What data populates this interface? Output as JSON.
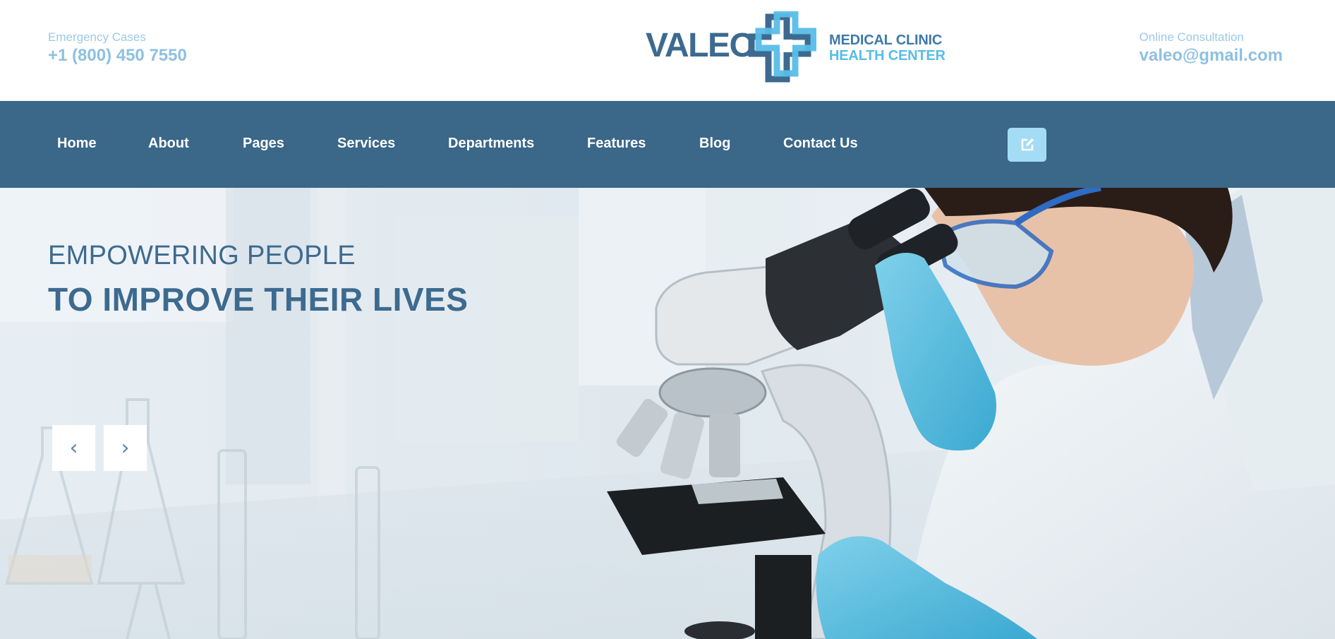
{
  "header": {
    "emergency_label": "Emergency Cases",
    "emergency_phone": "+1 (800) 450 7550",
    "consult_label": "Online Consultation",
    "consult_email": "valeo@gmail.com",
    "logo": {
      "word": "VALEO",
      "line1": "MEDICAL CLINIC",
      "line2": "HEALTH CENTER"
    }
  },
  "nav": {
    "items": [
      {
        "label": "Home"
      },
      {
        "label": "About"
      },
      {
        "label": "Pages"
      },
      {
        "label": "Services"
      },
      {
        "label": "Departments"
      },
      {
        "label": "Features"
      },
      {
        "label": "Blog"
      },
      {
        "label": "Contact Us"
      }
    ],
    "appointment_icon": "edit-icon"
  },
  "hero": {
    "subtitle": "EMPOWERING PEOPLE",
    "title": "TO IMPROVE THEIR LIVES",
    "prev_icon": "‹",
    "next_icon": "›"
  },
  "colors": {
    "nav_bg": "#3b6788",
    "brand_dark": "#3d6a8f",
    "brand_light": "#8ec0e2",
    "accent": "#a5dcf5"
  }
}
